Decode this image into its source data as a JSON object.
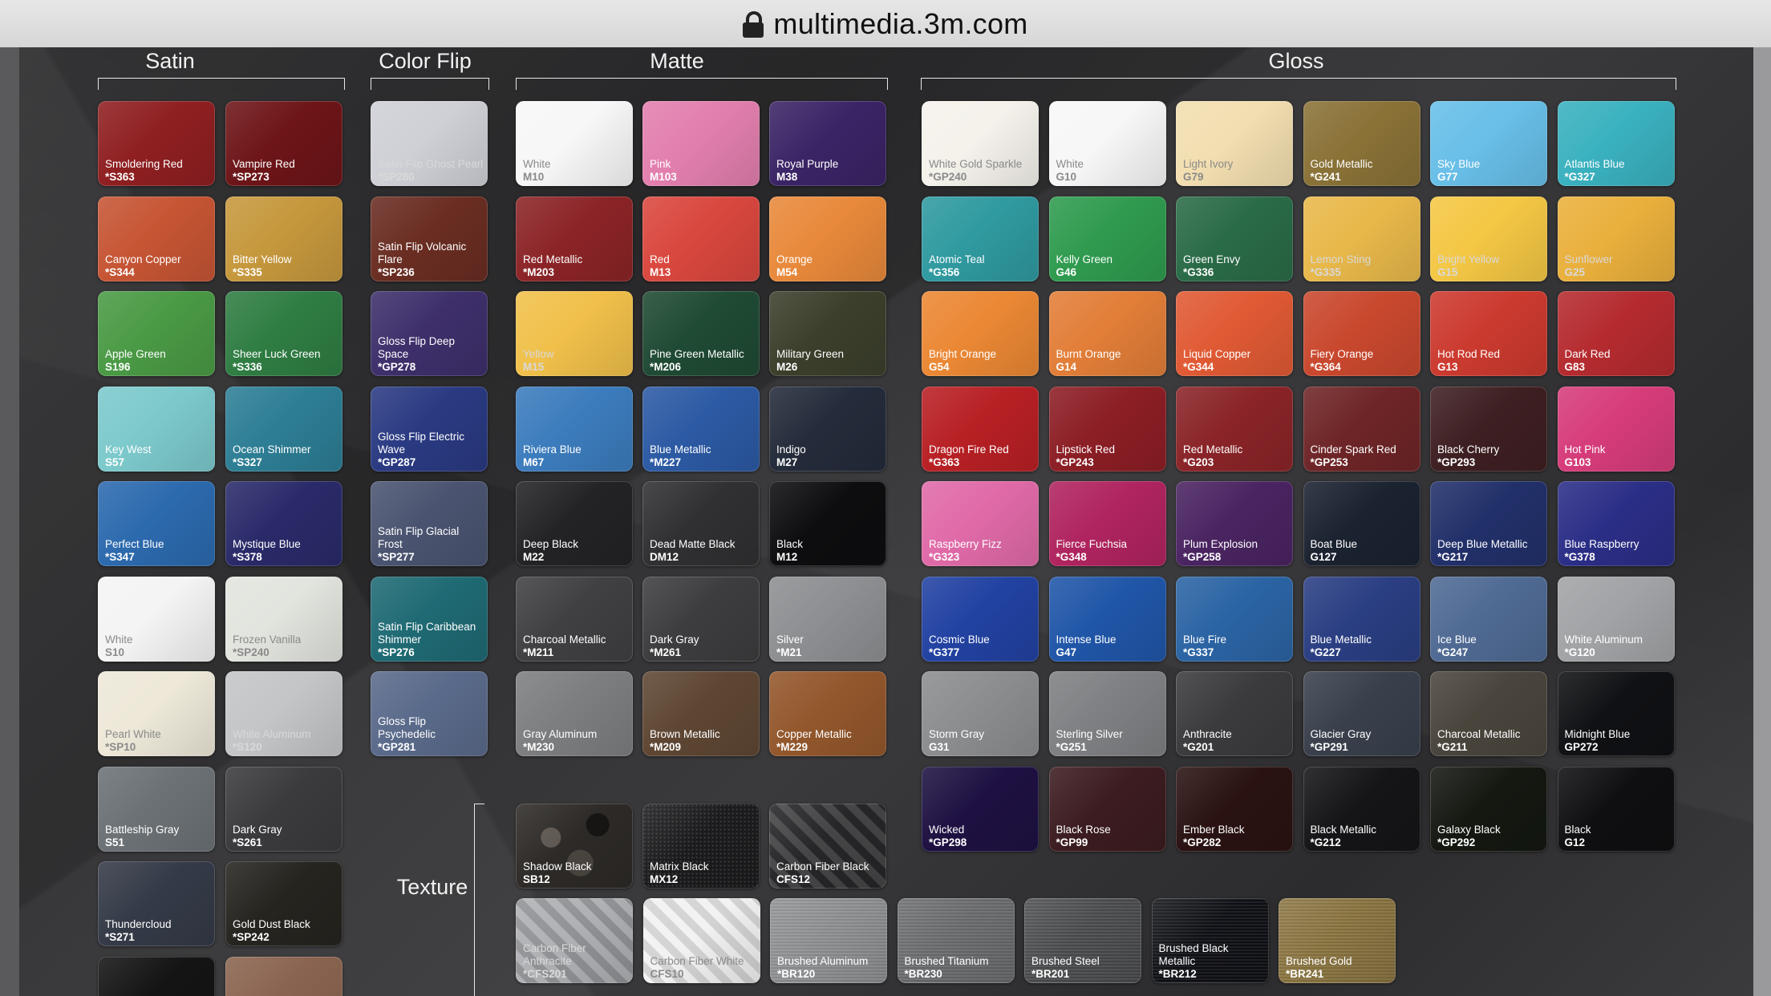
{
  "browser": {
    "url": "multimedia.3m.com"
  },
  "sections": {
    "satin": "Satin",
    "color_flip": "Color Flip",
    "matte": "Matte",
    "gloss": "Gloss",
    "texture": "Texture"
  },
  "swatches": {
    "satin": [
      {
        "name": "Smoldering Red",
        "code": "*S363",
        "color": "#8f1f21"
      },
      {
        "name": "Vampire Red",
        "code": "*SP273",
        "color": "#6d1518"
      },
      {
        "name": "Canyon Copper",
        "code": "*S344",
        "color": "#c65534"
      },
      {
        "name": "Bitter Yellow",
        "code": "*S335",
        "color": "#c6983d"
      },
      {
        "name": "Apple Green",
        "code": "S196",
        "color": "#4a9a45"
      },
      {
        "name": "Sheer Luck Green",
        "code": "*S336",
        "color": "#2f7d43"
      },
      {
        "name": "Key West",
        "code": "S57",
        "color": "#7cc9cc"
      },
      {
        "name": "Ocean Shimmer",
        "code": "*S327",
        "color": "#2d7e95"
      },
      {
        "name": "Perfect Blue",
        "code": "*S347",
        "color": "#2c6aae"
      },
      {
        "name": "Mystique Blue",
        "code": "*S378",
        "color": "#2a2a6a"
      },
      {
        "name": "White",
        "code": "S10",
        "color": "#f4f4f4"
      },
      {
        "name": "Frozen Vanilla",
        "code": "*SP240",
        "color": "#e2e4de"
      },
      {
        "name": "Pearl White",
        "code": "*SP10",
        "color": "#ede8d8"
      },
      {
        "name": "White Aluminum",
        "code": "*S120",
        "color": "#c4c5c7"
      },
      {
        "name": "Battleship Gray",
        "code": "S51",
        "color": "#6b7175"
      },
      {
        "name": "Dark Gray",
        "code": "*S261",
        "color": "#3b3b3e"
      },
      {
        "name": "Thundercloud",
        "code": "*S271",
        "color": "#343a47"
      },
      {
        "name": "Gold Dust Black",
        "code": "*SP242",
        "color": "#26241f"
      },
      {
        "name": "",
        "code": "",
        "color": "#141414"
      },
      {
        "name": "",
        "code": "",
        "color": "#8a6450"
      }
    ],
    "color_flip": [
      {
        "name": "Satin Flip Ghost Pearl",
        "code": "*SP280",
        "color": "#cfd0d6"
      },
      {
        "name": "Satin Flip Volcanic Flare",
        "code": "*SP236",
        "color": "#6a2d22"
      },
      {
        "name": "Gloss Flip Deep Space",
        "code": "*GP278",
        "color": "#3e2f6b"
      },
      {
        "name": "Gloss Flip Electric Wave",
        "code": "*GP287",
        "color": "#2a3a82"
      },
      {
        "name": "Satin Flip Glacial Frost",
        "code": "*SP277",
        "color": "#4a5470"
      },
      {
        "name": "Satin Flip Caribbean Shimmer",
        "code": "*SP276",
        "color": "#1f6a74"
      },
      {
        "name": "Gloss Flip Psychedelic",
        "code": "*GP281",
        "color": "#5a6a8a"
      }
    ],
    "matte": [
      {
        "name": "White",
        "code": "M10",
        "color": "#f7f7f7"
      },
      {
        "name": "Pink",
        "code": "M103",
        "color": "#e27fae"
      },
      {
        "name": "Royal Purple",
        "code": "M38",
        "color": "#3b2466"
      },
      {
        "name": "Red Metallic",
        "code": "*M203",
        "color": "#8b2427"
      },
      {
        "name": "Red",
        "code": "M13",
        "color": "#d9473e"
      },
      {
        "name": "Orange",
        "code": "M54",
        "color": "#e8893b"
      },
      {
        "name": "Yellow",
        "code": "M15",
        "color": "#f0c04a"
      },
      {
        "name": "Pine Green Metallic",
        "code": "*M206",
        "color": "#1f4a33"
      },
      {
        "name": "Military Green",
        "code": "M26",
        "color": "#3b3f2b"
      },
      {
        "name": "Riviera Blue",
        "code": "M67",
        "color": "#3c7cbd"
      },
      {
        "name": "Blue Metallic",
        "code": "*M227",
        "color": "#2c5aa4"
      },
      {
        "name": "Indigo",
        "code": "M27",
        "color": "#242b3a"
      },
      {
        "name": "Deep Black",
        "code": "M22",
        "color": "#232325"
      },
      {
        "name": "Dead Matte Black",
        "code": "DM12",
        "color": "#303032"
      },
      {
        "name": "Black",
        "code": "M12",
        "color": "#0d0d0f"
      },
      {
        "name": "Charcoal Metallic",
        "code": "*M211",
        "color": "#404042"
      },
      {
        "name": "Dark Gray",
        "code": "*M261",
        "color": "#3d3d3f"
      },
      {
        "name": "Silver",
        "code": "*M21",
        "color": "#8e8f92"
      },
      {
        "name": "Gray Aluminum",
        "code": "*M230",
        "color": "#7d7e80"
      },
      {
        "name": "Brown Metallic",
        "code": "*M209",
        "color": "#5e4633"
      },
      {
        "name": "Copper Metallic",
        "code": "*M229",
        "color": "#93572c"
      }
    ],
    "gloss": [
      {
        "name": "White Gold Sparkle",
        "code": "*GP240",
        "color": "#f5f2ec"
      },
      {
        "name": "White",
        "code": "G10",
        "color": "#f7f7f7"
      },
      {
        "name": "Light Ivory",
        "code": "G79",
        "color": "#f2deb0"
      },
      {
        "name": "Gold Metallic",
        "code": "*G241",
        "color": "#8a7237"
      },
      {
        "name": "Sky Blue",
        "code": "G77",
        "color": "#68bfe8"
      },
      {
        "name": "Atlantis Blue",
        "code": "*G327",
        "color": "#3ab1bf"
      },
      {
        "name": "Atomic Teal",
        "code": "*G356",
        "color": "#2f9aa0"
      },
      {
        "name": "Kelly Green",
        "code": "G46",
        "color": "#2f9b4f"
      },
      {
        "name": "Green Envy",
        "code": "*G336",
        "color": "#2a6b47"
      },
      {
        "name": "Lemon Sting",
        "code": "*G335",
        "color": "#e8b84a"
      },
      {
        "name": "Bright Yellow",
        "code": "G15",
        "color": "#f4c744"
      },
      {
        "name": "Sunflower",
        "code": "G25",
        "color": "#eab03c"
      },
      {
        "name": "Bright Orange",
        "code": "G54",
        "color": "#eb8834"
      },
      {
        "name": "Burnt Orange",
        "code": "G14",
        "color": "#e27e38"
      },
      {
        "name": "Liquid Copper",
        "code": "*G344",
        "color": "#e05a34"
      },
      {
        "name": "Fiery Orange",
        "code": "*G364",
        "color": "#c9482e"
      },
      {
        "name": "Hot Rod Red",
        "code": "G13",
        "color": "#cc3a2f"
      },
      {
        "name": "Dark Red",
        "code": "G83",
        "color": "#b52b2f"
      },
      {
        "name": "Dragon Fire Red",
        "code": "*G363",
        "color": "#b82024"
      },
      {
        "name": "Lipstick Red",
        "code": "*GP243",
        "color": "#8c1e25"
      },
      {
        "name": "Red Metallic",
        "code": "*G203",
        "color": "#8a2428"
      },
      {
        "name": "Cinder Spark Red",
        "code": "*GP253",
        "color": "#6e2527"
      },
      {
        "name": "Black Cherry",
        "code": "*GP293",
        "color": "#3e1f22"
      },
      {
        "name": "Hot Pink",
        "code": "G103",
        "color": "#d63c7a"
      },
      {
        "name": "Raspberry Fizz",
        "code": "*G323",
        "color": "#e06aa8"
      },
      {
        "name": "Fierce Fuchsia",
        "code": "*G348",
        "color": "#b0245f"
      },
      {
        "name": "Plum Explosion",
        "code": "*GP258",
        "color": "#4a2461"
      },
      {
        "name": "Boat Blue",
        "code": "G127",
        "color": "#1b2230"
      },
      {
        "name": "Deep Blue Metallic",
        "code": "*G217",
        "color": "#22306a"
      },
      {
        "name": "Blue Raspberry",
        "code": "*G378",
        "color": "#2b2e86"
      },
      {
        "name": "Cosmic Blue",
        "code": "*G377",
        "color": "#2242a2"
      },
      {
        "name": "Intense Blue",
        "code": "G47",
        "color": "#2056a8"
      },
      {
        "name": "Blue Fire",
        "code": "*G337",
        "color": "#2b64a4"
      },
      {
        "name": "Blue Metallic",
        "code": "*G227",
        "color": "#2a3e82"
      },
      {
        "name": "Ice Blue",
        "code": "*G247",
        "color": "#4f6a93"
      },
      {
        "name": "White Aluminum",
        "code": "*G120",
        "color": "#a2a3a6"
      },
      {
        "name": "Storm Gray",
        "code": "G31",
        "color": "#8c8d8f"
      },
      {
        "name": "Sterling Silver",
        "code": "*G251",
        "color": "#7f8083"
      },
      {
        "name": "Anthracite",
        "code": "*G201",
        "color": "#3b3b3d"
      },
      {
        "name": "Glacier Gray",
        "code": "*GP291",
        "color": "#39404c"
      },
      {
        "name": "Charcoal Metallic",
        "code": "*G211",
        "color": "#4a453c"
      },
      {
        "name": "Midnight Blue",
        "code": "GP272",
        "color": "#101114"
      },
      {
        "name": "Wicked",
        "code": "*GP298",
        "color": "#1e1142"
      },
      {
        "name": "Black Rose",
        "code": "*GP99",
        "color": "#3c1c20"
      },
      {
        "name": "Ember Black",
        "code": "*GP282",
        "color": "#2a1212"
      },
      {
        "name": "Black Metallic",
        "code": "*G212",
        "color": "#151517"
      },
      {
        "name": "Galaxy Black",
        "code": "*GP292",
        "color": "#141811"
      },
      {
        "name": "Black",
        "code": "G12",
        "color": "#0f0f11"
      }
    ],
    "texture": [
      {
        "name": "Shadow Black",
        "code": "SB12",
        "color": "#2d2a27"
      },
      {
        "name": "Matrix Black",
        "code": "MX12",
        "color": "#1b1b1d"
      },
      {
        "name": "Carbon Fiber Black",
        "code": "CFS12",
        "color": "#2b2b2d"
      },
      {
        "name": "Carbon Fiber Anthracite",
        "code": "*CFS201",
        "color": "#a4a6aa"
      },
      {
        "name": "Carbon Fiber White",
        "code": "CFS10",
        "color": "#f0f0f0"
      },
      {
        "name": "Brushed Aluminum",
        "code": "*BR120",
        "color": "#8e9093"
      },
      {
        "name": "Brushed Titanium",
        "code": "*BR230",
        "color": "#6b6c6e"
      },
      {
        "name": "Brushed Steel",
        "code": "*BR201",
        "color": "#4b4c4e"
      },
      {
        "name": "Brushed Black Metallic",
        "code": "*BR212",
        "color": "#0f1015"
      },
      {
        "name": "Brushed Gold",
        "code": "*BR241",
        "color": "#8a7440"
      }
    ]
  }
}
